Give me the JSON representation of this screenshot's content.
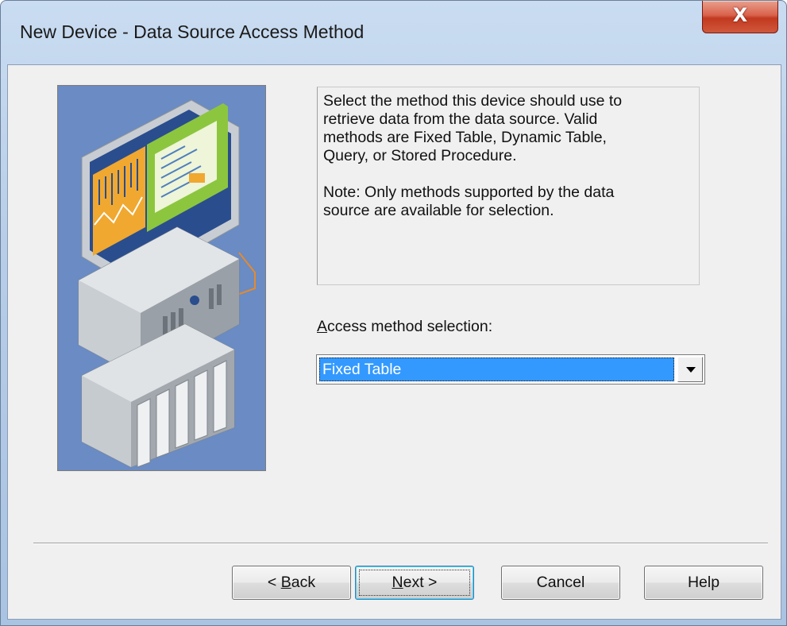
{
  "window": {
    "title": "New Device - Data Source Access Method",
    "close_glyph": "X"
  },
  "description": {
    "paragraph1": "Select the method this device should use to\nretrieve data from the data source.  Valid\nmethods are Fixed Table, Dynamic Table,\nQuery, or Stored Procedure.",
    "paragraph2": "Note: Only methods supported by the data\nsource are available for selection."
  },
  "access_method": {
    "label_mnemonic": "A",
    "label_rest": "ccess method selection:",
    "selected_value": "Fixed Table"
  },
  "buttons": {
    "back_prefix": "< ",
    "back_mnemonic": "B",
    "back_rest": "ack",
    "next_mnemonic": "N",
    "next_rest": "ext >",
    "cancel": "Cancel",
    "help": "Help"
  },
  "icons": {
    "close": "close-icon",
    "illustration": "computer-and-plc-illustration",
    "dropdown": "chevron-down-icon"
  },
  "colors": {
    "selection_highlight": "#3399ff",
    "illustration_background": "#6a8bc3",
    "close_button": "#c2391f"
  }
}
